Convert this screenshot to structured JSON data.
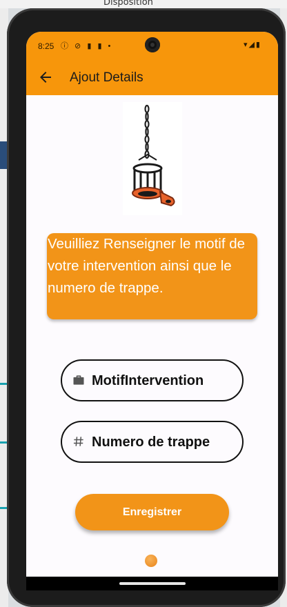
{
  "background": {
    "tab_label": "Disposition"
  },
  "status_bar": {
    "time": "8:25",
    "left_icons": "ⓘ ⊘ ▮ ▮ •",
    "right_icons": "▾◢▮"
  },
  "app_bar": {
    "title": "Ajout Details",
    "back_icon": "arrow-left-icon"
  },
  "notice": {
    "text": "Veuilliez Renseigner le motif de votre intervention ainsi que le numero de trappe."
  },
  "form": {
    "motif": {
      "placeholder": "MotifIntervention",
      "icon": "briefcase-icon"
    },
    "trappe": {
      "placeholder": "Numero de trappe",
      "icon": "hash-icon"
    },
    "save_label": "Enregistrer"
  },
  "colors": {
    "accent": "#f7960b",
    "button": "#f29418"
  }
}
